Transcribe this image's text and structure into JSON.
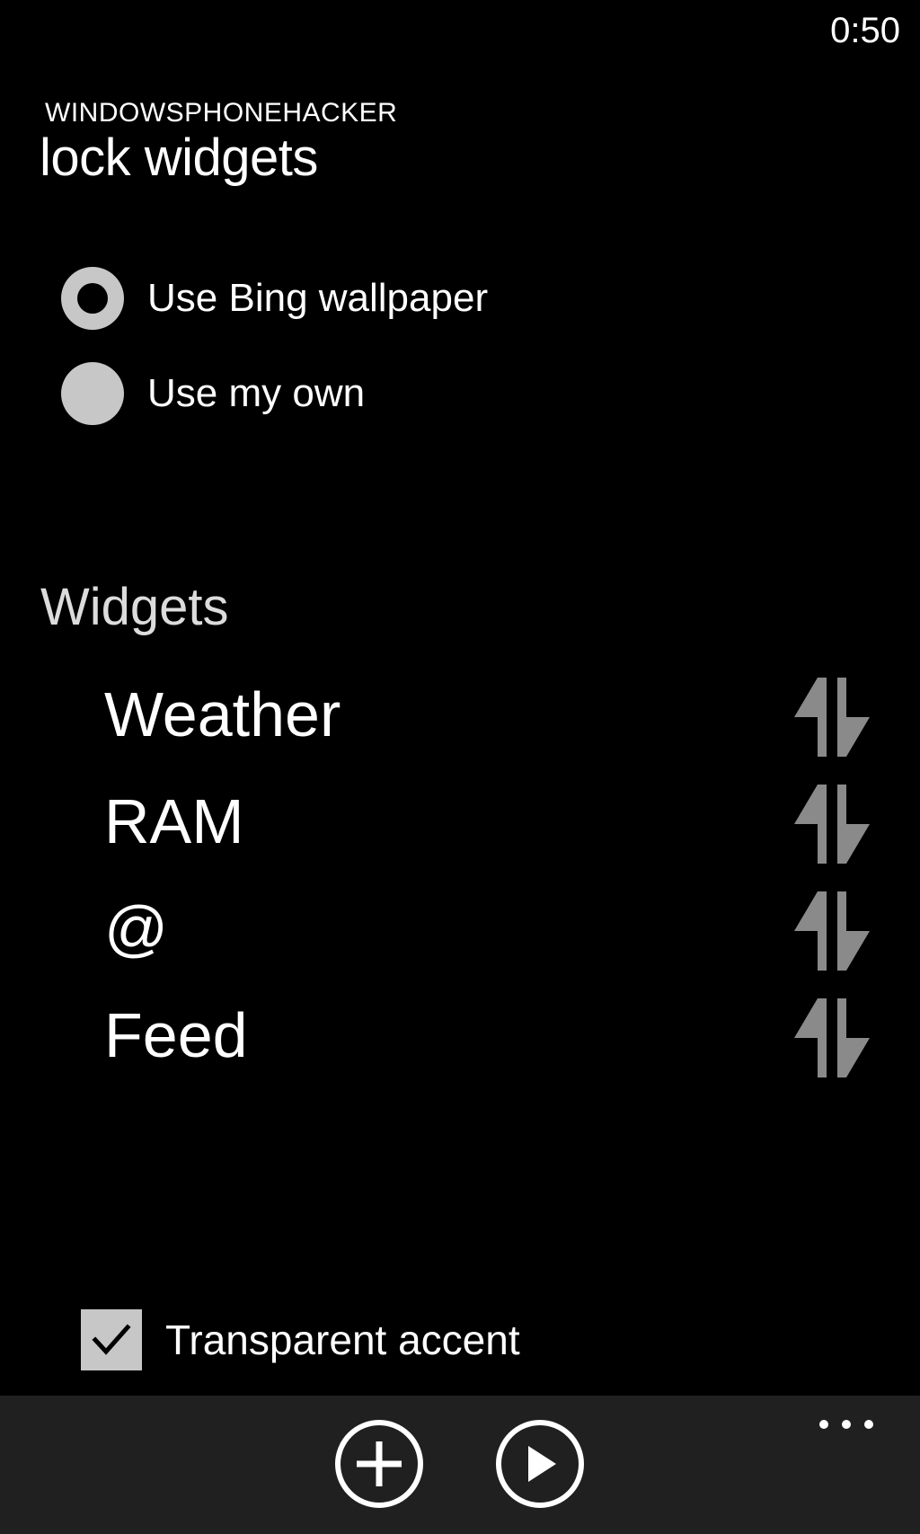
{
  "status_bar": {
    "time": "0:50"
  },
  "header": {
    "app_title": "WINDOWSPHONEHACKER",
    "page_title": "lock widgets"
  },
  "wallpaper_options": [
    {
      "label": "Use Bing wallpaper",
      "selected": true
    },
    {
      "label": "Use my own",
      "selected": false
    }
  ],
  "widgets_section": {
    "header": "Widgets",
    "items": [
      {
        "label": "Weather",
        "handle_icon": "reorder-arrows-icon"
      },
      {
        "label": "RAM",
        "handle_icon": "reorder-arrows-icon"
      },
      {
        "label": "@",
        "handle_icon": "reorder-arrows-icon"
      },
      {
        "label": "Feed",
        "handle_icon": "reorder-arrows-icon"
      }
    ]
  },
  "transparent_accent": {
    "label": "Transparent accent",
    "checked": true
  },
  "app_bar": {
    "buttons": [
      {
        "icon": "add-icon"
      },
      {
        "icon": "play-icon"
      }
    ],
    "more_icon": "ellipsis-icon"
  },
  "colors": {
    "background": "#000000",
    "control_gray": "#c7c7c7",
    "handle_gray": "#8a8a8a",
    "app_bar_bg": "#1f201f",
    "text": "#ffffff"
  }
}
